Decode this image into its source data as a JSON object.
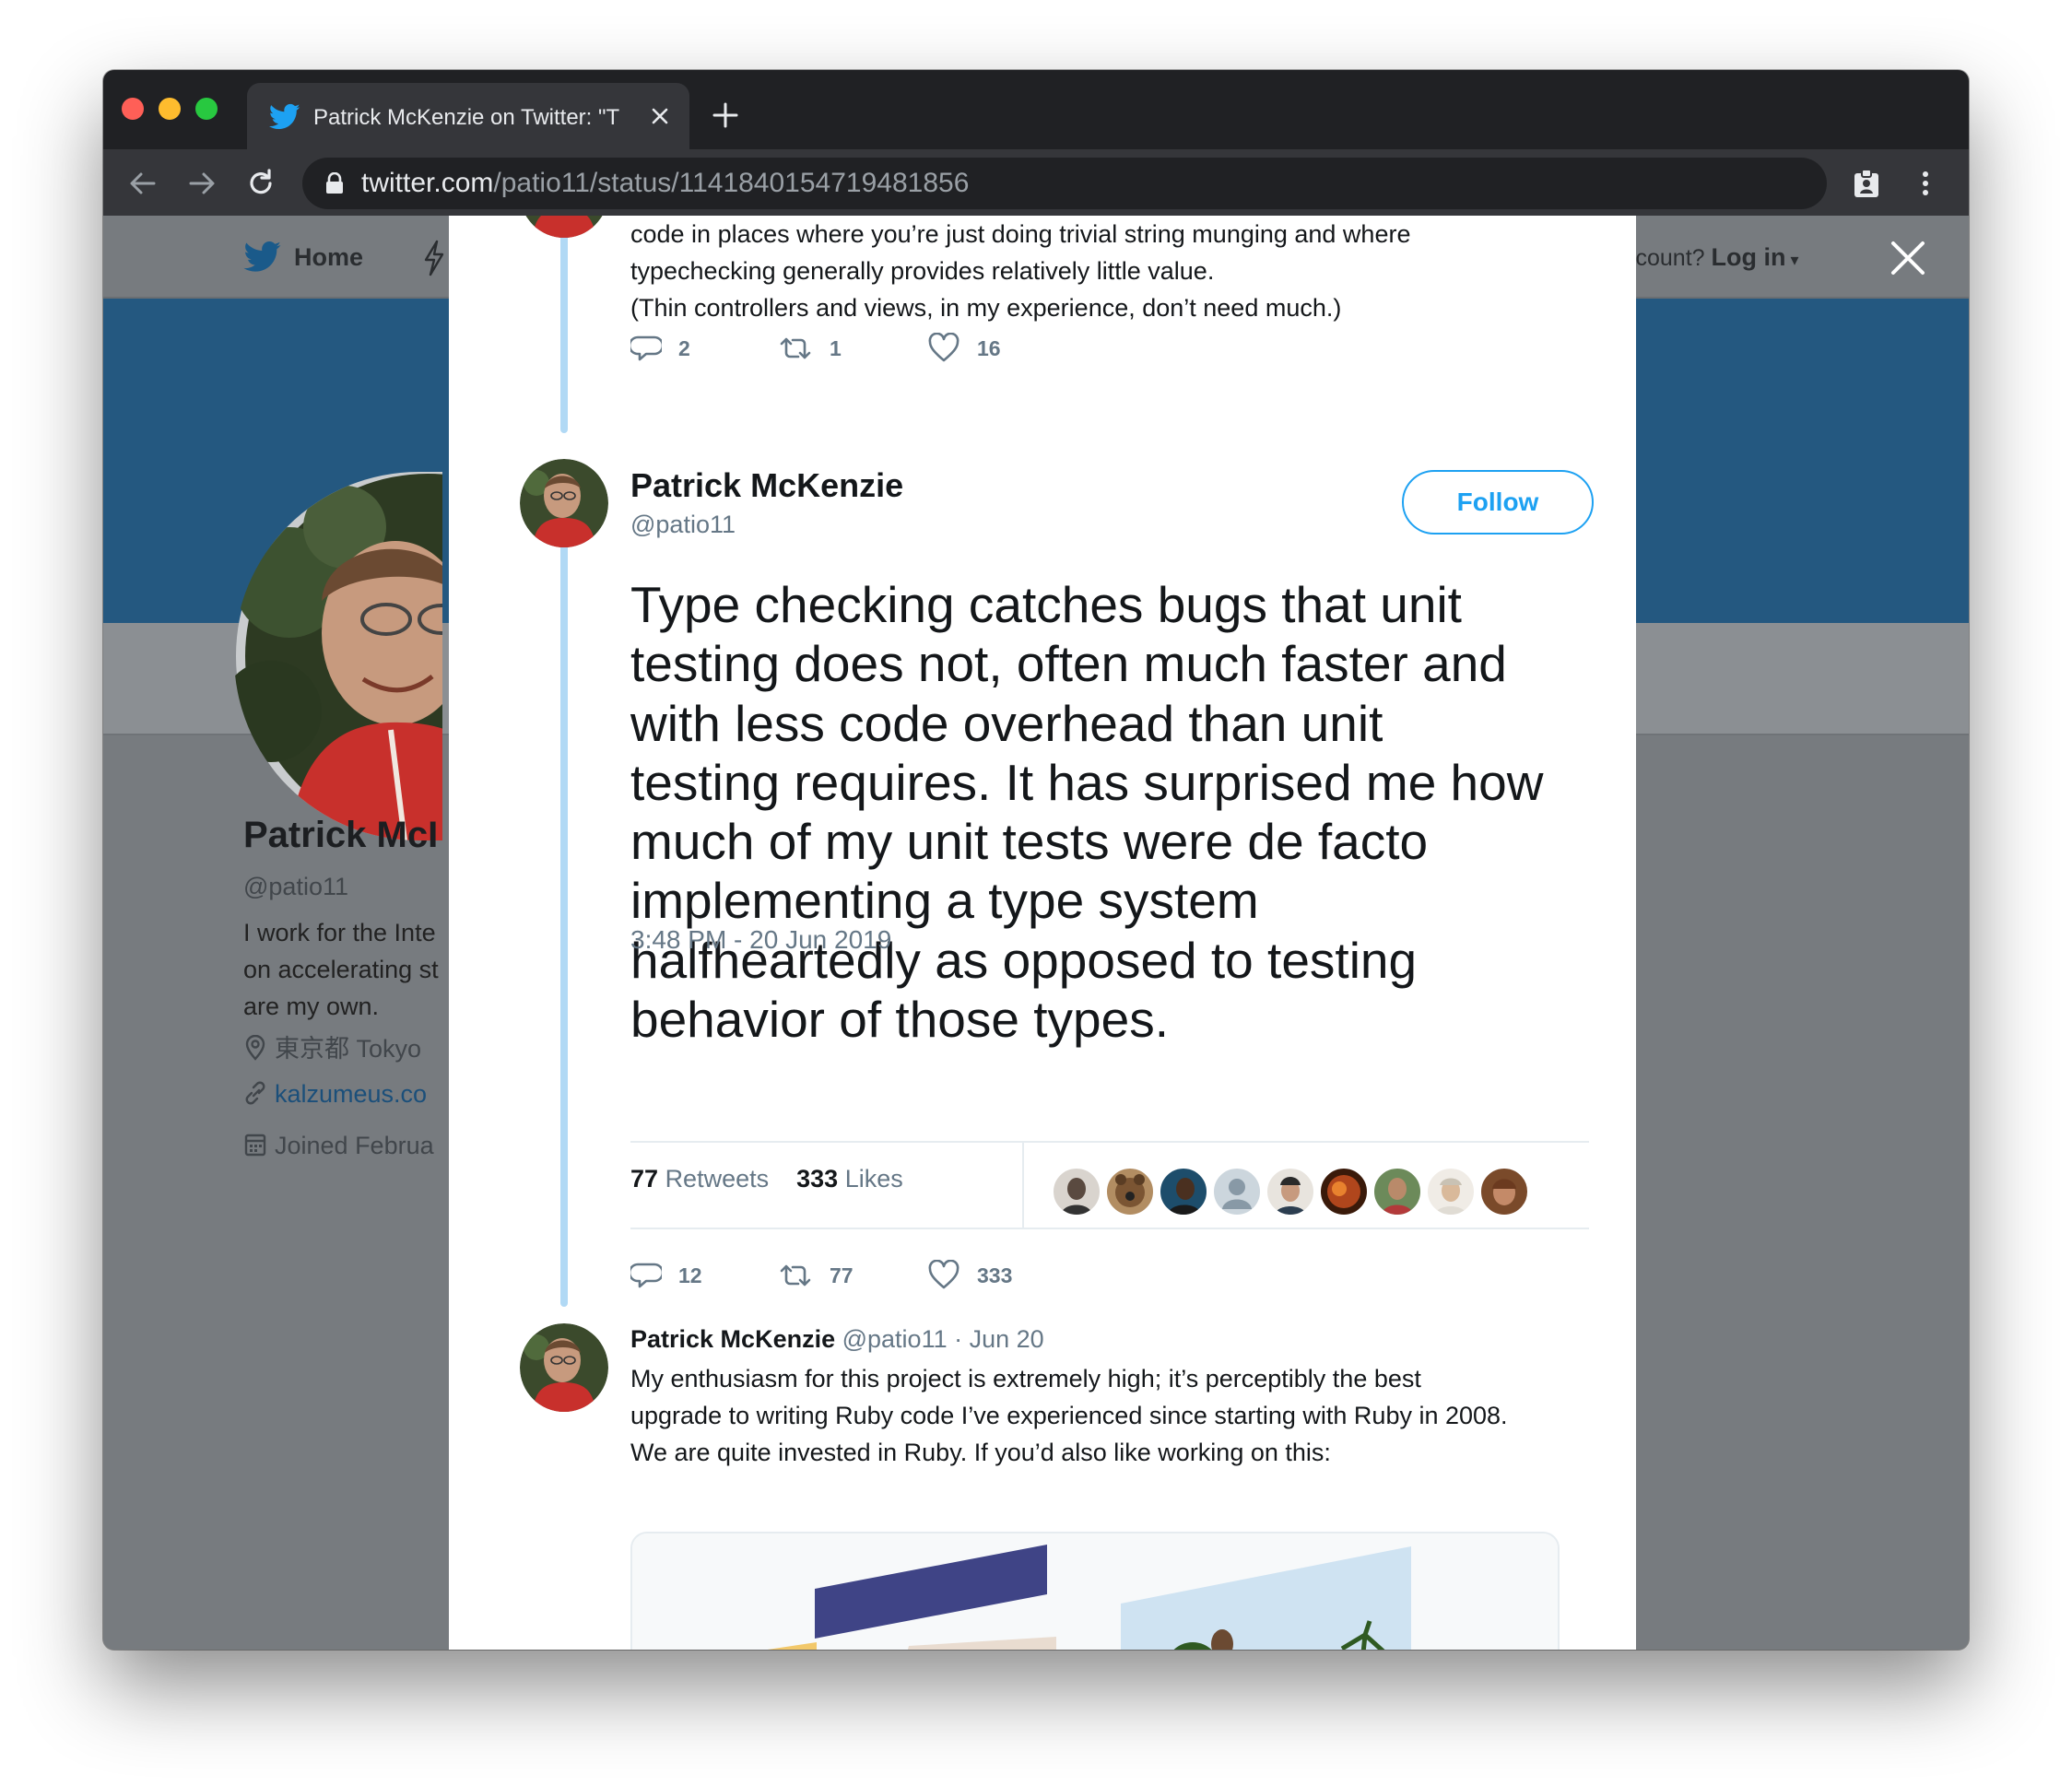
{
  "browser": {
    "tab_title": "Patrick McKenzie on Twitter: \"T",
    "url_host": "twitter.com",
    "url_path": "/patio11/status/1141840154719481856"
  },
  "nav": {
    "home_label": "Home",
    "account_prompt": "ccount?",
    "login_label": "Log in"
  },
  "profile": {
    "name": "Patrick McI",
    "handle": "@patio11",
    "bio_lines": [
      "I work for the Inte",
      "on accelerating st",
      "are my own."
    ],
    "location": "東京都 Tokyo",
    "website": "kalzumeus.co",
    "joined": "Joined Februa"
  },
  "prev_tweet": {
    "lines": [
      "code in places where you’re just doing trivial string munging and where",
      "typechecking generally provides relatively little value."
    ],
    "paragraph2": "(Thin controllers and views, in my experience, don’t need much.)",
    "replies": "2",
    "retweets": "1",
    "likes": "16"
  },
  "main_tweet": {
    "author_name": "Patrick McKenzie",
    "author_handle": "@patio11",
    "follow_label": "Follow",
    "text_lines": [
      "Type checking catches bugs that unit",
      "testing does not, often much faster and",
      "with less code overhead than unit",
      "testing requires. It has surprised me how",
      "much of my unit tests were de facto",
      "implementing a type system",
      "halfheartedly as opposed to testing",
      "behavior of those types."
    ],
    "timestamp": "3:48 PM - 20 Jun 2019",
    "retweet_count": "77",
    "retweet_label": "Retweets",
    "like_count": "333",
    "like_label": "Likes",
    "replies": "12",
    "retweets": "77",
    "likes": "333"
  },
  "next_tweet": {
    "author_name": "Patrick McKenzie",
    "author_handle": "@patio11",
    "date": "· Jun 20",
    "lines": [
      "My enthusiasm for this project is extremely high; it’s perceptibly the best",
      "upgrade to writing Ruby code I’ve experienced since starting with Ruby in 2008."
    ],
    "paragraph2": "We are quite invested in Ruby. If you’d also like working on this:"
  },
  "colors": {
    "twitter_blue": "#1da1f2",
    "thread_line": "#b1d9f5",
    "banner_dimmed": "#245880",
    "text_secondary": "#657786"
  },
  "icons": [
    "twitter-bird-icon",
    "close-icon",
    "plus-icon",
    "back-arrow-icon",
    "forward-arrow-icon",
    "reload-icon",
    "lock-icon",
    "extension-icon",
    "menu-dots-icon",
    "lightning-icon",
    "reply-icon",
    "retweet-icon",
    "heart-icon",
    "chevron-down-icon",
    "location-pin-icon",
    "link-icon",
    "calendar-icon"
  ]
}
